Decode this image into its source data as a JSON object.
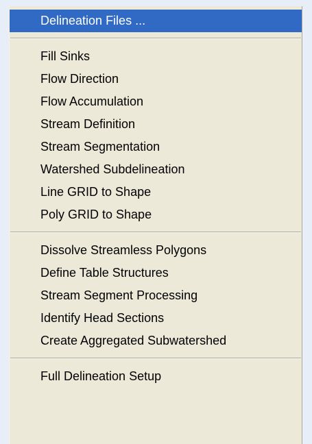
{
  "menu": {
    "highlight_color": "#316ac5",
    "background_color": "#ece9d8",
    "items": [
      {
        "label": "Delineation Files ..."
      },
      {
        "label": "Fill Sinks"
      },
      {
        "label": "Flow Direction"
      },
      {
        "label": "Flow Accumulation"
      },
      {
        "label": "Stream Definition"
      },
      {
        "label": "Stream Segmentation"
      },
      {
        "label": "Watershed Subdelineation"
      },
      {
        "label": "Line GRID to Shape"
      },
      {
        "label": "Poly GRID to Shape"
      },
      {
        "label": "Dissolve Streamless Polygons"
      },
      {
        "label": "Define Table Structures"
      },
      {
        "label": "Stream Segment Processing"
      },
      {
        "label": "Identify Head Sections"
      },
      {
        "label": "Create Aggregated Subwatershed"
      },
      {
        "label": "Full Delineation Setup"
      }
    ]
  }
}
